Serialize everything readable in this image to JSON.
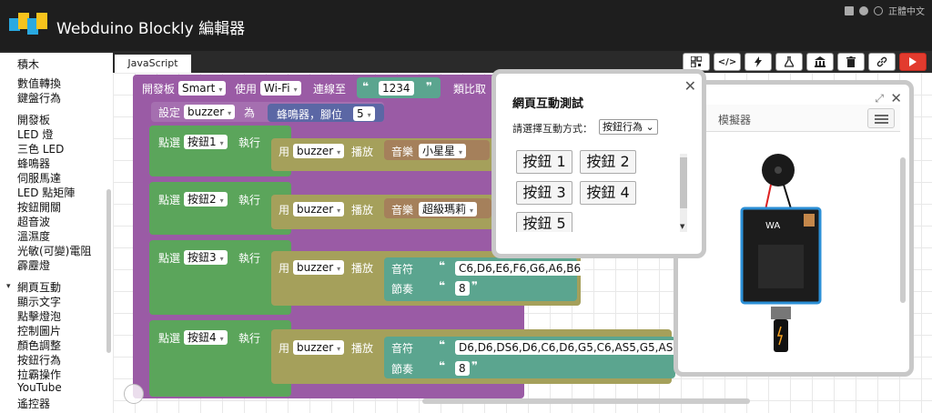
{
  "header": {
    "title": "Webduino Blockly 編輯器",
    "language": "正體中文"
  },
  "sidebar": {
    "categories": [
      "積木",
      "數值轉換",
      "鍵盤行為",
      "開發板",
      "LED 燈",
      "三色 LED",
      "蜂鳴器",
      "伺服馬達",
      "LED 點矩陣",
      "按鈕開關",
      "超音波",
      "溫濕度",
      "光敏(可變)電阻",
      "霹靂燈",
      "網頁互動",
      "顯示文字",
      "點擊燈泡",
      "控制圖片",
      "顏色調整",
      "按鈕行為",
      "拉霸操作",
      "YouTube",
      "遙控器"
    ]
  },
  "tabs": {
    "javascript": "JavaScript"
  },
  "toolbar": {
    "code_label": "</>"
  },
  "blocks": {
    "board": {
      "prefix": "開發板",
      "type": "Smart",
      "use": "使用",
      "conn": "Wi-Fi",
      "connect_to": "連線至",
      "device_id": "1234",
      "tail": "類比取"
    },
    "setvar": {
      "label": "設定",
      "var": "buzzer",
      "as": "為",
      "device": "蜂鳴器，腳位",
      "pin": "5"
    },
    "events": [
      {
        "click": "點選",
        "button": "按鈕1",
        "run": "執行",
        "use": "用",
        "var": "buzzer",
        "play": "播放",
        "music": "音樂",
        "song": "小星星"
      },
      {
        "click": "點選",
        "button": "按鈕2",
        "run": "執行",
        "use": "用",
        "var": "buzzer",
        "play": "播放",
        "music": "音樂",
        "song": "超級瑪莉"
      },
      {
        "click": "點選",
        "button": "按鈕3",
        "run": "執行",
        "use": "用",
        "var": "buzzer",
        "play": "播放",
        "note": "音符",
        "notes": "C6,D6,E6,F6,G6,A6,B6",
        "beat": "節奏",
        "tempo": "8"
      },
      {
        "click": "點選",
        "button": "按鈕4",
        "run": "執行",
        "use": "用",
        "var": "buzzer",
        "play": "播放",
        "note": "音符",
        "notes": "D6,D6,DS6,D6,C6,D6,G5,C6,AS5,G5,AS5",
        "beat": "節奏",
        "tempo": "8"
      }
    ]
  },
  "dialog": {
    "title": "網頁互動測試",
    "choose_label": "請選擇互動方式：",
    "mode": "按鈕行為",
    "buttons": [
      "按鈕 1",
      "按鈕 2",
      "按鈕 3",
      "按鈕 4",
      "按鈕 5"
    ]
  },
  "simulator": {
    "title": "模擬器"
  },
  "colors": {
    "header_bg": "#1e1e1e",
    "run_button": "#e23b2e",
    "block_board": "#9a5ba5",
    "block_event": "#5ba55b",
    "block_play": "#a5a05b"
  }
}
